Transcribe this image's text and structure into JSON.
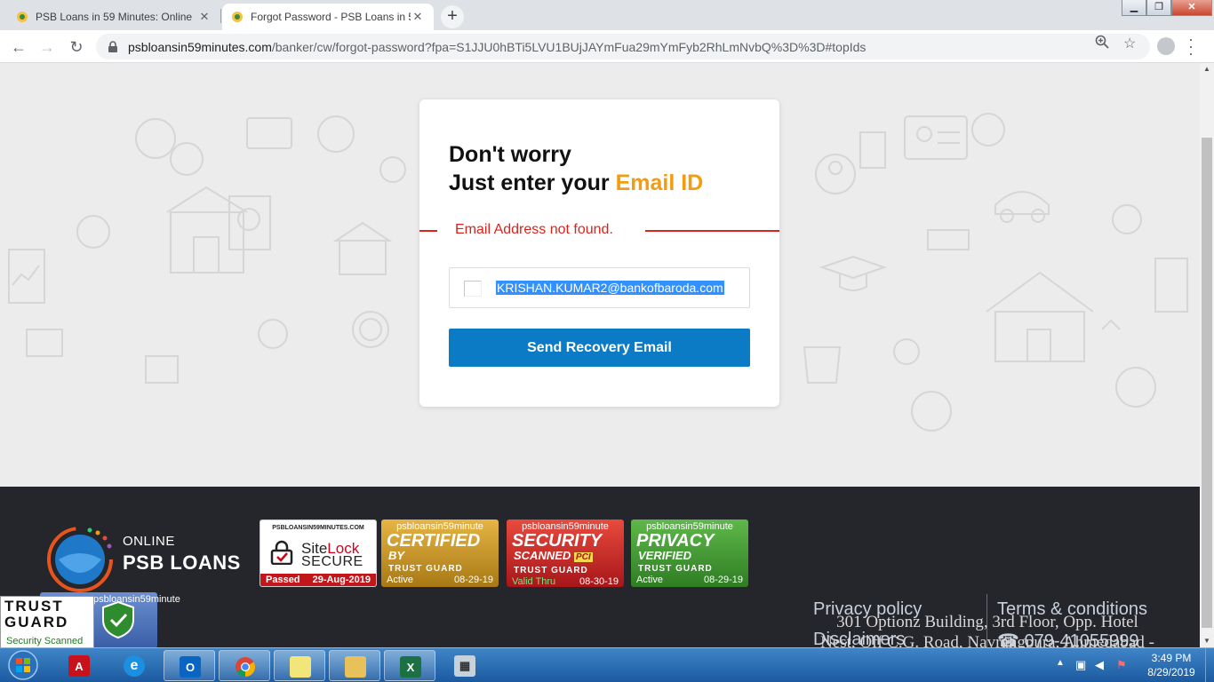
{
  "browser": {
    "tabs": [
      {
        "title": "PSB Loans in 59 Minutes: Online",
        "active": false
      },
      {
        "title": "Forgot Password - PSB Loans in 5",
        "active": true
      }
    ],
    "new_tab_icon": "plus-icon",
    "url_host": "psbloansin59minutes.com",
    "url_path": "/banker/cw/forgot-password?fpa=S1JJU0hBTi5LVU1BUjJAYmFua29mYmFyb2RhLmNvbQ%3D%3D#topIds",
    "accent": "#f39c12"
  },
  "card": {
    "heading_line1": "Don't worry",
    "heading_line2_prefix": "Just enter your ",
    "heading_line2_accent": "Email ID",
    "error_message": "Email Address not found.",
    "email_value": "KRISHAN.KUMAR2@bankofbaroda.com",
    "submit_label": "Send Recovery Email",
    "error_color": "#d9231d",
    "button_color": "#0b7bc6"
  },
  "footer": {
    "logo_line1": "ONLINE",
    "logo_line2": "PSB LOANS",
    "badges": {
      "sitelock": {
        "domain": "PSBLOANSIN59MINUTES.COM",
        "brand_a": "Site",
        "brand_b": "Lock",
        "secure": "SECURE",
        "status": "Passed",
        "date": "29-Aug-2019"
      },
      "certified": {
        "site": "psbloansin59minute",
        "main": "CERTIFIED",
        "sub": "BY",
        "tg": "TRUST  GUARD",
        "status": "Active",
        "date": "08-29-19"
      },
      "security": {
        "site": "psbloansin59minute",
        "main": "SECURITY",
        "sub": "SCANNED",
        "pci": "PCI",
        "tg": "TRUST  GUARD",
        "status": "Valid Thru",
        "date": "08-30-19"
      },
      "privacy": {
        "site": "psbloansin59minute",
        "main": "PRIVACY",
        "sub": "VERIFIED",
        "tg": "TRUST  GUARD",
        "status": "Active",
        "date": "08-29-19"
      }
    },
    "links": {
      "privacy": "Privacy policy",
      "disclaimers": "Disclaimers",
      "terms": "Terms & conditions",
      "phone": "079-41055999"
    },
    "address_line1": "301 Optionz Building, 3rd Floor, Opp. Hotel",
    "address_line2": "Nest, Off C.G. Road, Navrangpura, Ahmedabad -",
    "trust_seal": {
      "line1": "TRUST",
      "line2": "GUARD",
      "line3": "Security Scanned",
      "back_text": "psbloansin59minute"
    }
  },
  "taskbar": {
    "apps": [
      "acrobat-icon",
      "internet-explorer-icon",
      "outlook-icon",
      "chrome-icon",
      "sticky-notes-icon",
      "file-explorer-icon",
      "excel-icon",
      "calculator-icon"
    ],
    "time": "3:49 PM",
    "date": "8/29/2019"
  }
}
